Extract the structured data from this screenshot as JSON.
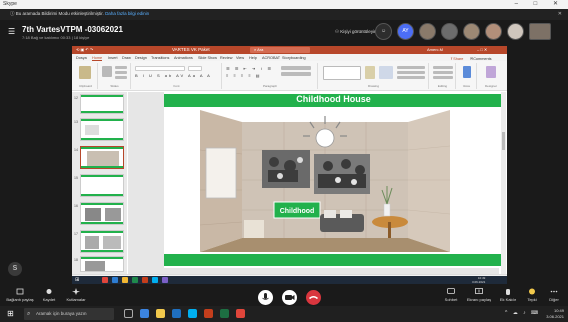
{
  "window": {
    "app_name": "Skype",
    "controls": "–  □  ✕"
  },
  "banner": {
    "text": "Bu aramada Bildirimi Modu etkinleştirilmiştir.",
    "link": "Daha fazla bilgi edinin",
    "close": "✕"
  },
  "meeting": {
    "title": "7th VartesVTPM -03062021",
    "subtitle": "7:18 Bağ ve katılımcı 00:33 | 18 kişiye",
    "invite": "Kişiyi görüntüleyin"
  },
  "participants": [
    {
      "initials": ""
    },
    {
      "initials": "AY"
    },
    {
      "initials": ""
    },
    {
      "initials": ""
    },
    {
      "initials": ""
    },
    {
      "initials": ""
    },
    {
      "initials": ""
    },
    {
      "initials": ""
    }
  ],
  "ppt": {
    "window_title": "VARTES VK Paket",
    "search": "Ara",
    "user": "Amerc.M",
    "menu": [
      "Dosya",
      "Home",
      "Insert",
      "Draw",
      "Design",
      "Transitions",
      "Animations",
      "Slide Show",
      "Review",
      "View",
      "Help",
      "ACROBAT",
      "Storyboarding"
    ],
    "share": "Share",
    "comments": "Comments",
    "ribbon_groups": [
      "Clipboard",
      "Slides",
      "Font",
      "Paragraph",
      "Drawing",
      "Editing",
      "Voice",
      "Designer"
    ],
    "slide_title": "Childhood House",
    "sign_text": "Childhood",
    "thumb_numbers": [
      "12",
      "13",
      "14",
      "15",
      "16",
      "17",
      "18"
    ],
    "status_left": "Slide 14 of 21",
    "status_right": "Notes   Comments"
  },
  "call_controls": {
    "left": [
      {
        "label": "Bağlantı paylaş"
      },
      {
        "label": "Kaydet"
      },
      {
        "label": "Kutlamalar"
      }
    ],
    "right": [
      {
        "label": "Sohbet"
      },
      {
        "label": "Ekranı paylaş"
      },
      {
        "label": "Ek Kaldır"
      },
      {
        "label": "Tepki"
      },
      {
        "label": "Diğer"
      }
    ]
  },
  "taskbar": {
    "search_placeholder": "Aramak için buraya yazın",
    "time": "10:49",
    "date": "3.06.2021",
    "inner_time": "10:49",
    "inner_date": "3.06.2021"
  },
  "colors": {
    "ppt_accent": "#b7472a",
    "slide_green": "#22b14c",
    "end_call": "#d9363e"
  }
}
